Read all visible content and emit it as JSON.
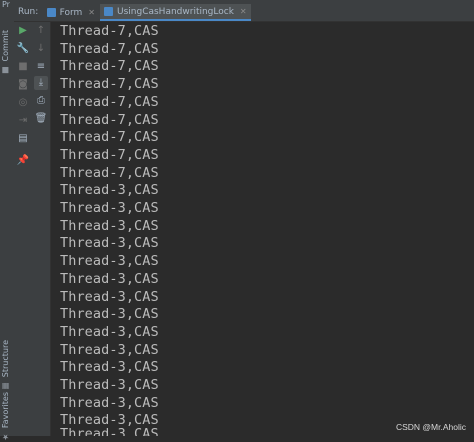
{
  "left_sidebar": {
    "top_tool": "Pr",
    "commit_tab": "Commit",
    "structure_tab": "Structure",
    "favorites_tab": "Favorites"
  },
  "run_tabs": {
    "run_label": "Run:",
    "tabs": [
      {
        "label": "Form",
        "active": false
      },
      {
        "label": "UsingCasHandwritingLock",
        "active": true
      }
    ]
  },
  "toolbar": {
    "icons": [
      "rerun-icon",
      "settings-wrench-icon",
      "stop-icon",
      "camera-icon",
      "exit-icon",
      "layout-icon",
      "pin-icon",
      "up-arrow-icon",
      "down-arrow-icon",
      "soft-wrap-icon",
      "scroll-to-end-icon",
      "print-icon",
      "trash-icon"
    ],
    "run_color": "#59a869"
  },
  "console": {
    "lines": [
      "Thread-7,CAS",
      "Thread-7,CAS",
      "Thread-7,CAS",
      "Thread-7,CAS",
      "Thread-7,CAS",
      "Thread-7,CAS",
      "Thread-7,CAS",
      "Thread-7,CAS",
      "Thread-7,CAS",
      "Thread-3,CAS",
      "Thread-3,CAS",
      "Thread-3,CAS",
      "Thread-3,CAS",
      "Thread-3,CAS",
      "Thread-3,CAS",
      "Thread-3,CAS",
      "Thread-3,CAS",
      "Thread-3,CAS",
      "Thread-3,CAS",
      "Thread-3,CAS",
      "Thread-3,CAS",
      "Thread-3,CAS",
      "Thread-3,CAS",
      "Thread-3,CAS"
    ]
  },
  "watermark": "CSDN @Mr.Aholic"
}
